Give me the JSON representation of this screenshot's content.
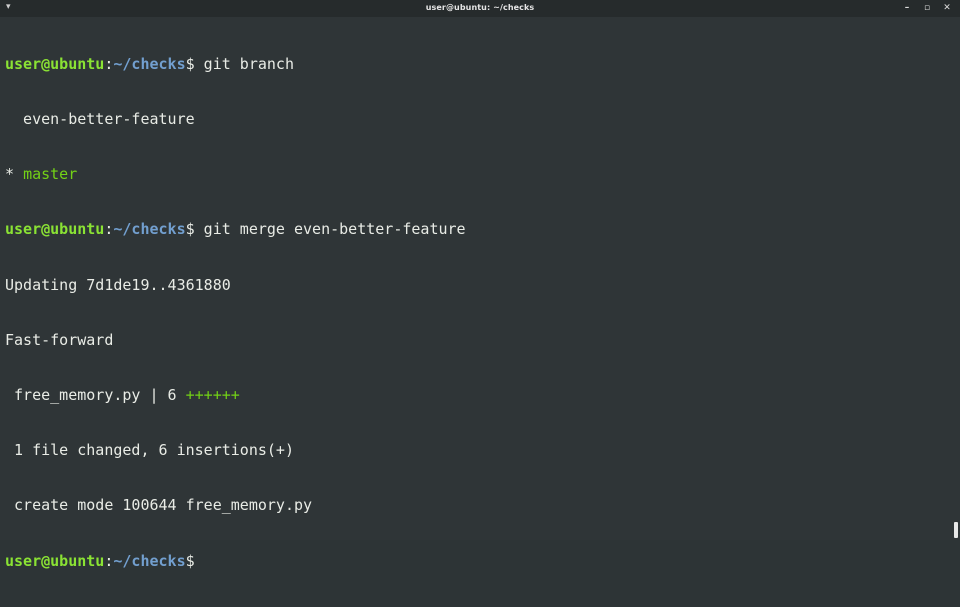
{
  "window": {
    "title": "user@ubuntu: ~/checks",
    "menu_glyph": "▾",
    "minimize": "–",
    "maximize": "▫",
    "close": "✕"
  },
  "prompt": {
    "user": "user@ubuntu",
    "colon": ":",
    "path": "~/checks",
    "dollar": "$"
  },
  "lines": {
    "cmd1": " git branch",
    "branch1": "  even-better-feature",
    "branch2_star": "* ",
    "branch2_name": "master",
    "cmd2": " git merge even-better-feature",
    "out1": "Updating 7d1de19..4361880",
    "out2": "Fast-forward",
    "out3_text": " free_memory.py | 6 ",
    "out3_plus": "++++++",
    "out4": " 1 file changed, 6 insertions(+)",
    "out5": " create mode 100644 free_memory.py"
  }
}
